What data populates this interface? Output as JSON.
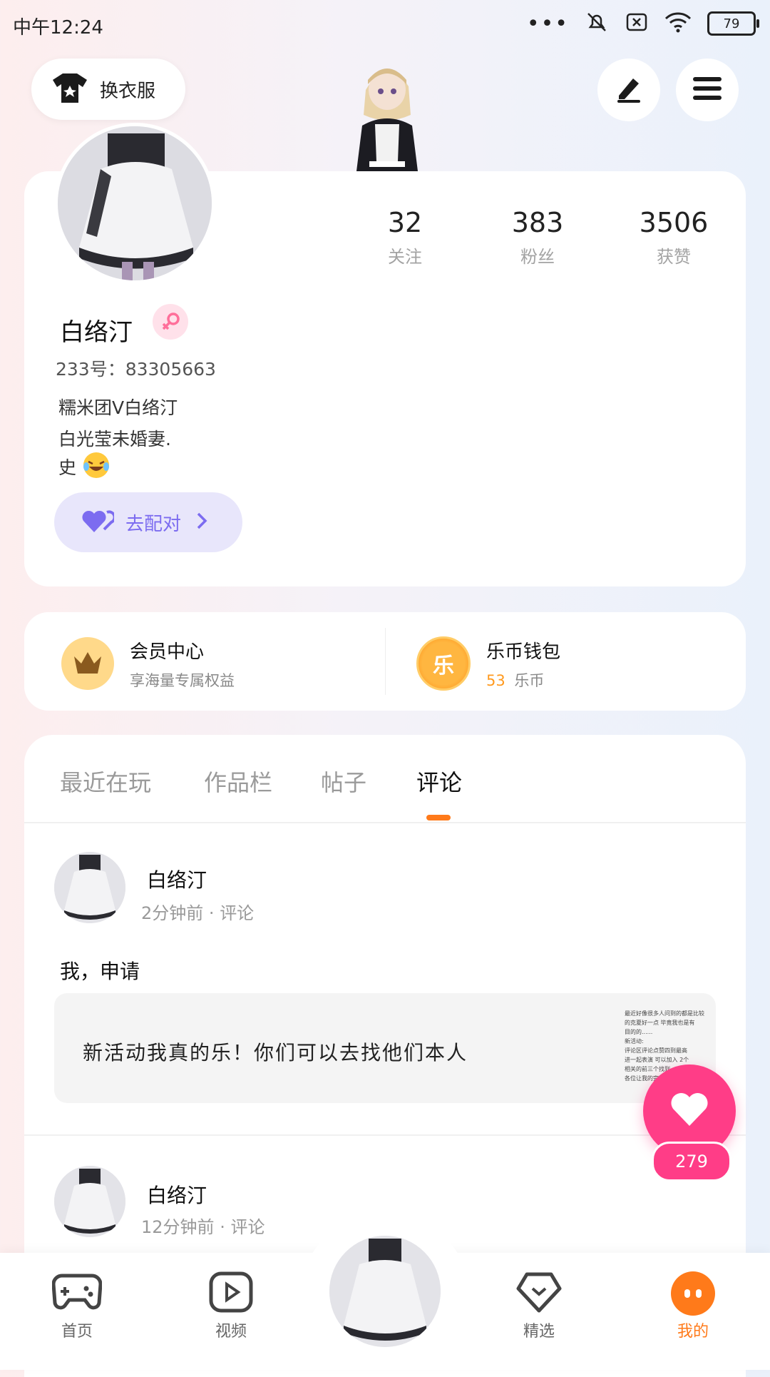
{
  "status_bar": {
    "time": "中午12:24",
    "more_dots": "•••",
    "battery": "79"
  },
  "header": {
    "outfit_label": "换衣服"
  },
  "stats": [
    {
      "value": "32",
      "label": "关注"
    },
    {
      "value": "383",
      "label": "粉丝"
    },
    {
      "value": "3506",
      "label": "获赞"
    }
  ],
  "profile": {
    "name": "白络汀",
    "id_line": "233号：83305663",
    "bio_lines": [
      "糯米团V白络汀",
      "白光莹未婚妻.",
      "史"
    ],
    "pair_button": "去配对"
  },
  "benefits": [
    {
      "title": "会员中心",
      "subtitle": "享海量专属权益",
      "icon": "crown-icon"
    },
    {
      "title": "乐币钱包",
      "amount": "53",
      "unit": "乐币",
      "coin_glyph": "乐",
      "icon": "coin-icon"
    }
  ],
  "tabs": [
    {
      "label": "最近在玩",
      "active": false
    },
    {
      "label": "作品栏",
      "active": false
    },
    {
      "label": "帖子",
      "active": false
    },
    {
      "label": "评论",
      "active": true
    }
  ],
  "comments": [
    {
      "name": "白络汀",
      "time": "2分钟前",
      "type": "评论",
      "text": "我，申请",
      "quoted": "新活动我真的乐！你们可以去找他们本人",
      "thumb_lines": [
        "最近好像很多人问到的都是比较",
        "的克夏好一点 毕竟我也是有",
        "目的的......",
        "新活动:",
        "评论区评论点赞四到最高",
        "进一起表演 可以加入 2个",
        "相关的前三个找到",
        "各位让我的完全好~"
      ]
    },
    {
      "name": "白络汀",
      "time": "12分钟前",
      "type": "评论"
    }
  ],
  "like_button": {
    "count": "279"
  },
  "bottom_nav": [
    {
      "label": "首页",
      "icon": "gamepad-icon"
    },
    {
      "label": "视频",
      "icon": "play-icon"
    },
    {
      "label": "",
      "icon": "avatar-center"
    },
    {
      "label": "精选",
      "icon": "heart-badge-icon"
    },
    {
      "label": "我的",
      "icon": "me-icon"
    }
  ],
  "colors": {
    "accent": "#ff7a1a",
    "like": "#ff3d87",
    "pair": "#7c6cf0",
    "pair_bg": "#e8e6fb",
    "coin": "#ff9a1f"
  }
}
